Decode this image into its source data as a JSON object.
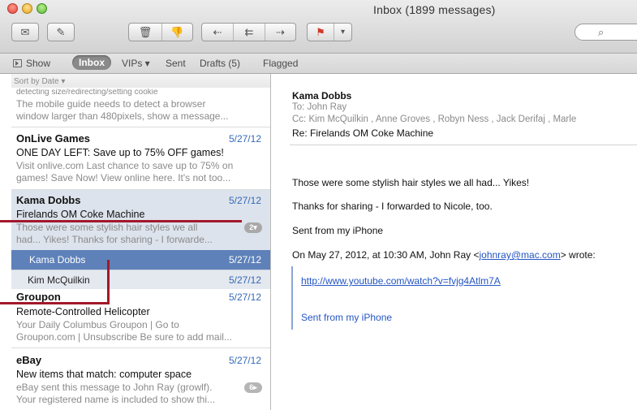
{
  "window": {
    "title": "Inbox (1899 messages)"
  },
  "toolbar": {
    "buttons": [
      {
        "name": "get-mail-button",
        "icon": "envelope-icon",
        "glyph": "✉"
      },
      {
        "name": "compose-button",
        "icon": "compose-icon",
        "glyph": "✎"
      },
      {
        "name": "delete-button",
        "icon": "trash-icon",
        "glyph": "🗑"
      },
      {
        "name": "junk-button",
        "icon": "thumbs-down-icon",
        "glyph": "👎"
      },
      {
        "name": "reply-button",
        "icon": "reply-icon",
        "glyph": "⇠"
      },
      {
        "name": "reply-all-button",
        "icon": "reply-all-icon",
        "glyph": "⇇"
      },
      {
        "name": "forward-button",
        "icon": "forward-icon",
        "glyph": "⇢"
      },
      {
        "name": "flag-button",
        "icon": "flag-icon",
        "glyph": "⚑"
      },
      {
        "name": "flag-menu-button",
        "icon": "chevron-down-icon",
        "glyph": "▾"
      }
    ],
    "search": {
      "placeholder": "",
      "icon": "search-icon",
      "glyph": "⌕"
    }
  },
  "favorites": {
    "show": "Show",
    "inbox": "Inbox",
    "vips": "VIPs ▾",
    "sent": "Sent",
    "drafts": "Drafts (5)",
    "flagged": "Flagged"
  },
  "list": {
    "sort_label": "Sort by Date ▾",
    "messages": [
      {
        "from": "",
        "date": "",
        "subject": "",
        "preview": [
          "detecting size/redirecting/setting cookie",
          "The mobile guide needs to detect a browser",
          "window larger than 480pixels, show a message..."
        ]
      },
      {
        "from": "OnLive Games",
        "date": "5/27/12",
        "subject": "ONE DAY LEFT: Save up to 75% OFF games!",
        "preview": [
          "Visit onlive.com Last chance to save up to 75% on",
          "games! Save Now! View online here. It's not too..."
        ]
      },
      {
        "from": "Kama Dobbs",
        "date": "5/27/12",
        "subject": "Firelands OM Coke Machine",
        "preview": [
          "Those were some stylish hair styles we all",
          "had... Yikes! Thanks for sharing - I forwarde..."
        ],
        "badge": "2▾",
        "thread": [
          {
            "name": "Kama Dobbs",
            "date": "5/27/12",
            "selected": true
          },
          {
            "name": "Kim McQuilkin",
            "date": "5/27/12",
            "selected": false
          }
        ]
      },
      {
        "from": "Groupon",
        "date": "5/27/12",
        "subject": "Remote-Controlled Helicopter",
        "preview": [
          "Your Daily Columbus Groupon | Go to",
          "Groupon.com | Unsubscribe Be sure to add mail..."
        ]
      },
      {
        "from": "eBay",
        "date": "5/27/12",
        "subject": "New items that match: computer space",
        "preview": [
          "eBay sent this message to John Ray (growlf).",
          "Your registered name is included to show thi..."
        ],
        "badge": "6▸"
      }
    ]
  },
  "message": {
    "from": "Kama Dobbs",
    "to": "To:  John Ray",
    "cc": "Cc:  Kim McQuilkin ,  Anne Groves ,  Robyn Ness ,  Jack Derifaj ,  Marle",
    "subject": "Re: Firelands OM Coke Machine",
    "body": [
      "Those were some stylish hair styles we all had... Yikes!",
      "Thanks for sharing - I forwarded to Nicole, too.",
      "Sent from my iPhone"
    ],
    "attribution_prefix": "On May 27, 2012, at 10:30 AM, John Ray <",
    "attribution_email": "johnray@mac.com",
    "attribution_suffix": "> wrote:",
    "quoted_link": "http://www.youtube.com/watch?v=fvjg4Atlm7A",
    "quoted_sig": "Sent from my iPhone"
  },
  "colors": {
    "accent": "#5e81b9",
    "date_blue": "#3469b7",
    "callout": "#a3182a"
  }
}
